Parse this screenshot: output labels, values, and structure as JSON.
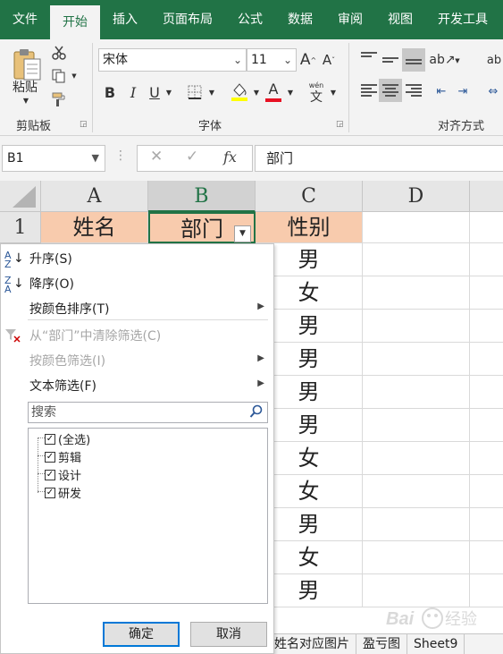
{
  "ribbon_tabs": [
    "文件",
    "开始",
    "插入",
    "页面布局",
    "公式",
    "数据",
    "审阅",
    "视图",
    "开发工具"
  ],
  "active_tab": "开始",
  "clipboard": {
    "paste_label": "粘贴",
    "group_label": "剪贴板"
  },
  "font": {
    "name": "宋体",
    "size": "11",
    "group_label": "字体",
    "wen": "wén",
    "wen_char": "文"
  },
  "font_color": "#e81123",
  "alignment": {
    "group_label": "对齐方式",
    "ab": "ab"
  },
  "name_box": "B1",
  "formula": {
    "fx": "fx",
    "value": "部门"
  },
  "columns": [
    "A",
    "B",
    "C",
    "D"
  ],
  "selected_column": "B",
  "row_numbers": [
    "1"
  ],
  "header_row": [
    "姓名",
    "部门",
    "性别"
  ],
  "gender_values": [
    "男",
    "女",
    "男",
    "男",
    "男",
    "男",
    "女",
    "女",
    "男",
    "女",
    "男"
  ],
  "header_fill": "#f8cbad",
  "filter_menu": {
    "sort_asc": "升序(S)",
    "sort_desc": "降序(O)",
    "sort_by_color": "按颜色排序(T)",
    "clear_filter": "从“部门”中清除筛选(C)",
    "filter_by_color": "按颜色筛选(I)",
    "text_filter": "文本筛选(F)",
    "search_placeholder": "搜索",
    "items": [
      "(全选)",
      "剪辑",
      "设计",
      "研发"
    ],
    "ok": "确定",
    "cancel": "取消"
  },
  "sheet_tabs": [
    "姓名对应图片",
    "盈亏图",
    "Sheet9"
  ],
  "watermark": "Bai 经验"
}
